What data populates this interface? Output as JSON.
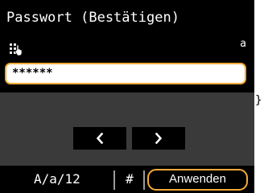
{
  "screen": {
    "title": "Passwort (Bestätigen)",
    "input_mode": "a"
  },
  "password_field": {
    "value": "******"
  },
  "navigation": {
    "left_icon": "chevron-left-icon",
    "right_icon": "chevron-right-icon"
  },
  "bottom_bar": {
    "case_toggle_label": "A/a/12",
    "symbol_label": "#",
    "apply_label": "Anwenden"
  },
  "stray_text": "}",
  "icons": {
    "keyboard": "keyboard-icon"
  },
  "colors": {
    "accent": "#f2a93a",
    "panel": "#000000",
    "area": "#3a3a3a",
    "field": "#ffffff"
  }
}
